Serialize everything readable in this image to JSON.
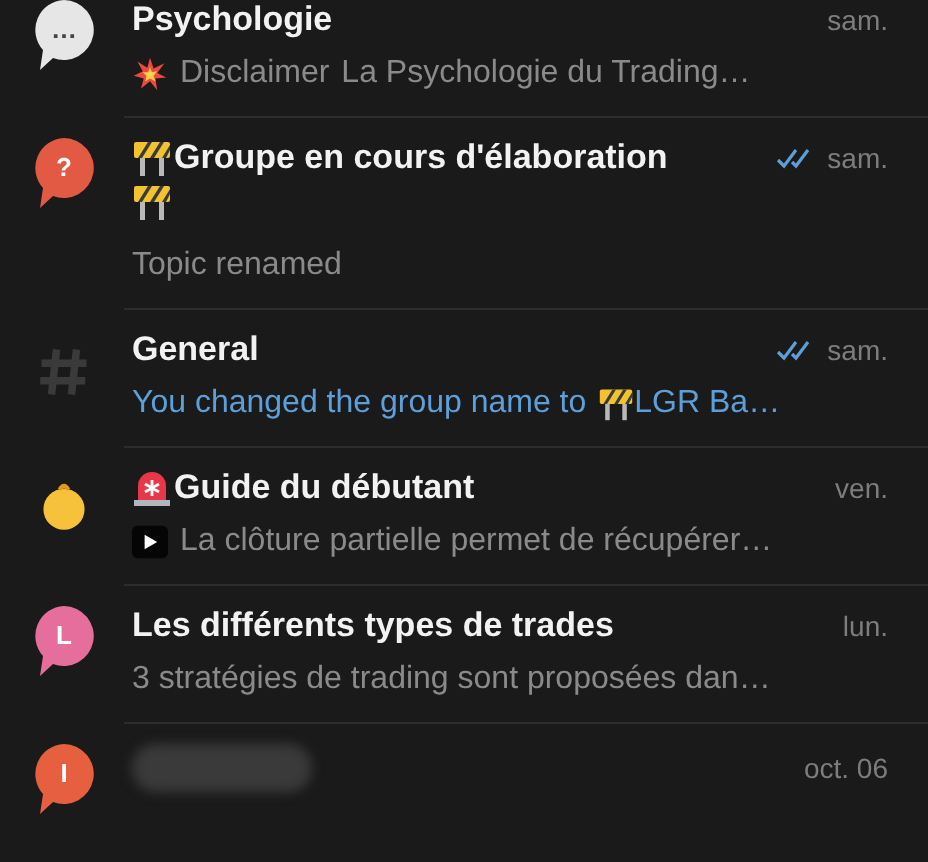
{
  "topics": [
    {
      "avatar": {
        "kind": "bubble",
        "color": "#e6e6e6",
        "glyph": "…"
      },
      "title": "Psychologie",
      "redacted": false,
      "read": false,
      "time": "sam.",
      "preview": [
        {
          "kind": "burst"
        },
        {
          "kind": "muted-text",
          "text": "Disclaimer"
        },
        {
          "kind": "muted-text",
          "text": "La Psychologie du Trading…"
        }
      ]
    },
    {
      "avatar": {
        "kind": "bubble",
        "color": "#e35a44",
        "glyph": "?"
      },
      "title_lead": {
        "kind": "barrier"
      },
      "title": "Groupe en cours d'élaboration",
      "title_wrap": {
        "kind": "barrier"
      },
      "redacted": false,
      "read": true,
      "time": "sam.",
      "preview": [
        {
          "kind": "muted-text",
          "text": "Topic renamed"
        }
      ]
    },
    {
      "avatar": {
        "kind": "hash"
      },
      "title": "General",
      "redacted": false,
      "read": true,
      "time": "sam.",
      "preview": [
        {
          "kind": "accent-text",
          "text": "You changed the group name to"
        },
        {
          "kind": "barrier"
        },
        {
          "kind": "accent-text",
          "text": "LGR Ba…"
        }
      ]
    },
    {
      "avatar": {
        "kind": "baby"
      },
      "title_lead": {
        "kind": "siren"
      },
      "title": "Guide du débutant",
      "redacted": false,
      "read": false,
      "time": "ven.",
      "preview": [
        {
          "kind": "video"
        },
        {
          "kind": "muted-text",
          "text": "La clôture partielle permet de récupérer…"
        }
      ]
    },
    {
      "avatar": {
        "kind": "bubble",
        "color": "#e66e9c",
        "glyph": "L"
      },
      "title": "Les différents types de trades",
      "redacted": false,
      "read": false,
      "time": "lun.",
      "preview": [
        {
          "kind": "muted-text",
          "text": "3 stratégies de trading sont proposées dan…"
        }
      ]
    },
    {
      "avatar": {
        "kind": "bubble",
        "color": "#e6603f",
        "glyph": "I"
      },
      "redacted": true,
      "read": false,
      "time": "oct. 06"
    }
  ]
}
